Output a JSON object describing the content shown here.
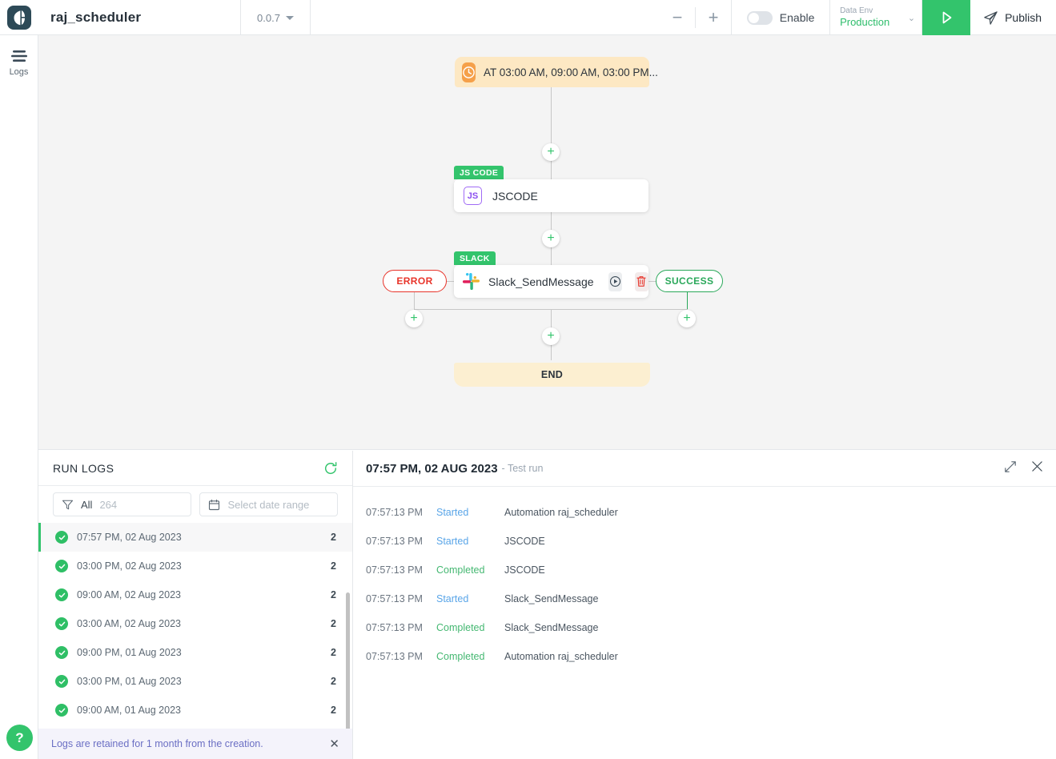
{
  "topbar": {
    "logo_icon": "app-logo-icon",
    "title": "raj_scheduler",
    "version": "0.0.7",
    "zoom_out_label": "−",
    "zoom_in_label": "+",
    "enable_label": "Enable",
    "env_label": "Data Env",
    "env_value": "Production",
    "run_icon": "play-icon",
    "publish_label": "Publish",
    "publish_icon": "send-icon"
  },
  "rail": {
    "logs_label": "Logs",
    "logs_icon": "logs-bars-icon",
    "help_label": "?"
  },
  "canvas": {
    "trigger": {
      "icon": "clock-icon",
      "text": "AT 03:00 AM, 09:00 AM, 03:00 PM..."
    },
    "jscode": {
      "badge": "JS CODE",
      "icon": "js-icon",
      "name": "JSCODE"
    },
    "slack": {
      "badge": "SLACK",
      "icon": "slack-icon",
      "name": "Slack_SendMessage",
      "run_icon": "play-circle-icon",
      "delete_icon": "trash-icon"
    },
    "error_label": "ERROR",
    "success_label": "SUCCESS",
    "end_label": "END",
    "add_label": "+",
    "colors": {
      "trigger_bg": "#fde8c3",
      "end_bg": "#fcefd1",
      "badge_green": "#33c46c",
      "error_red": "#e8342a",
      "success_green": "#2aa85a"
    }
  },
  "runlogs": {
    "title": "RUN LOGS",
    "refresh_icon": "refresh-icon",
    "filter": {
      "icon": "funnel-icon",
      "label": "All",
      "count": "264"
    },
    "date": {
      "icon": "calendar-icon",
      "placeholder": "Select date range"
    },
    "items": [
      {
        "time": "07:57 PM, 02 Aug 2023",
        "count": "2",
        "status_icon": "check-circle-icon"
      },
      {
        "time": "03:00 PM, 02 Aug 2023",
        "count": "2",
        "status_icon": "check-circle-icon"
      },
      {
        "time": "09:00 AM, 02 Aug 2023",
        "count": "2",
        "status_icon": "check-circle-icon"
      },
      {
        "time": "03:00 AM, 02 Aug 2023",
        "count": "2",
        "status_icon": "check-circle-icon"
      },
      {
        "time": "09:00 PM, 01 Aug 2023",
        "count": "2",
        "status_icon": "check-circle-icon"
      },
      {
        "time": "03:00 PM, 01 Aug 2023",
        "count": "2",
        "status_icon": "check-circle-icon"
      },
      {
        "time": "09:00 AM, 01 Aug 2023",
        "count": "2",
        "status_icon": "check-circle-icon"
      }
    ],
    "retention_notice": "Logs are retained for 1 month from the creation.",
    "retention_close_icon": "close-icon"
  },
  "detail": {
    "title": "07:57 PM, 02 AUG 2023",
    "subtitle": "- Test run",
    "expand_icon": "expand-icon",
    "close_icon": "close-icon",
    "rows": [
      {
        "time": "07:57:13 PM",
        "status": "Started",
        "message": "Automation raj_scheduler"
      },
      {
        "time": "07:57:13 PM",
        "status": "Started",
        "message": "JSCODE"
      },
      {
        "time": "07:57:13 PM",
        "status": "Completed",
        "message": "JSCODE"
      },
      {
        "time": "07:57:13 PM",
        "status": "Started",
        "message": "Slack_SendMessage"
      },
      {
        "time": "07:57:13 PM",
        "status": "Completed",
        "message": "Slack_SendMessage"
      },
      {
        "time": "07:57:13 PM",
        "status": "Completed",
        "message": "Automation raj_scheduler"
      }
    ]
  }
}
